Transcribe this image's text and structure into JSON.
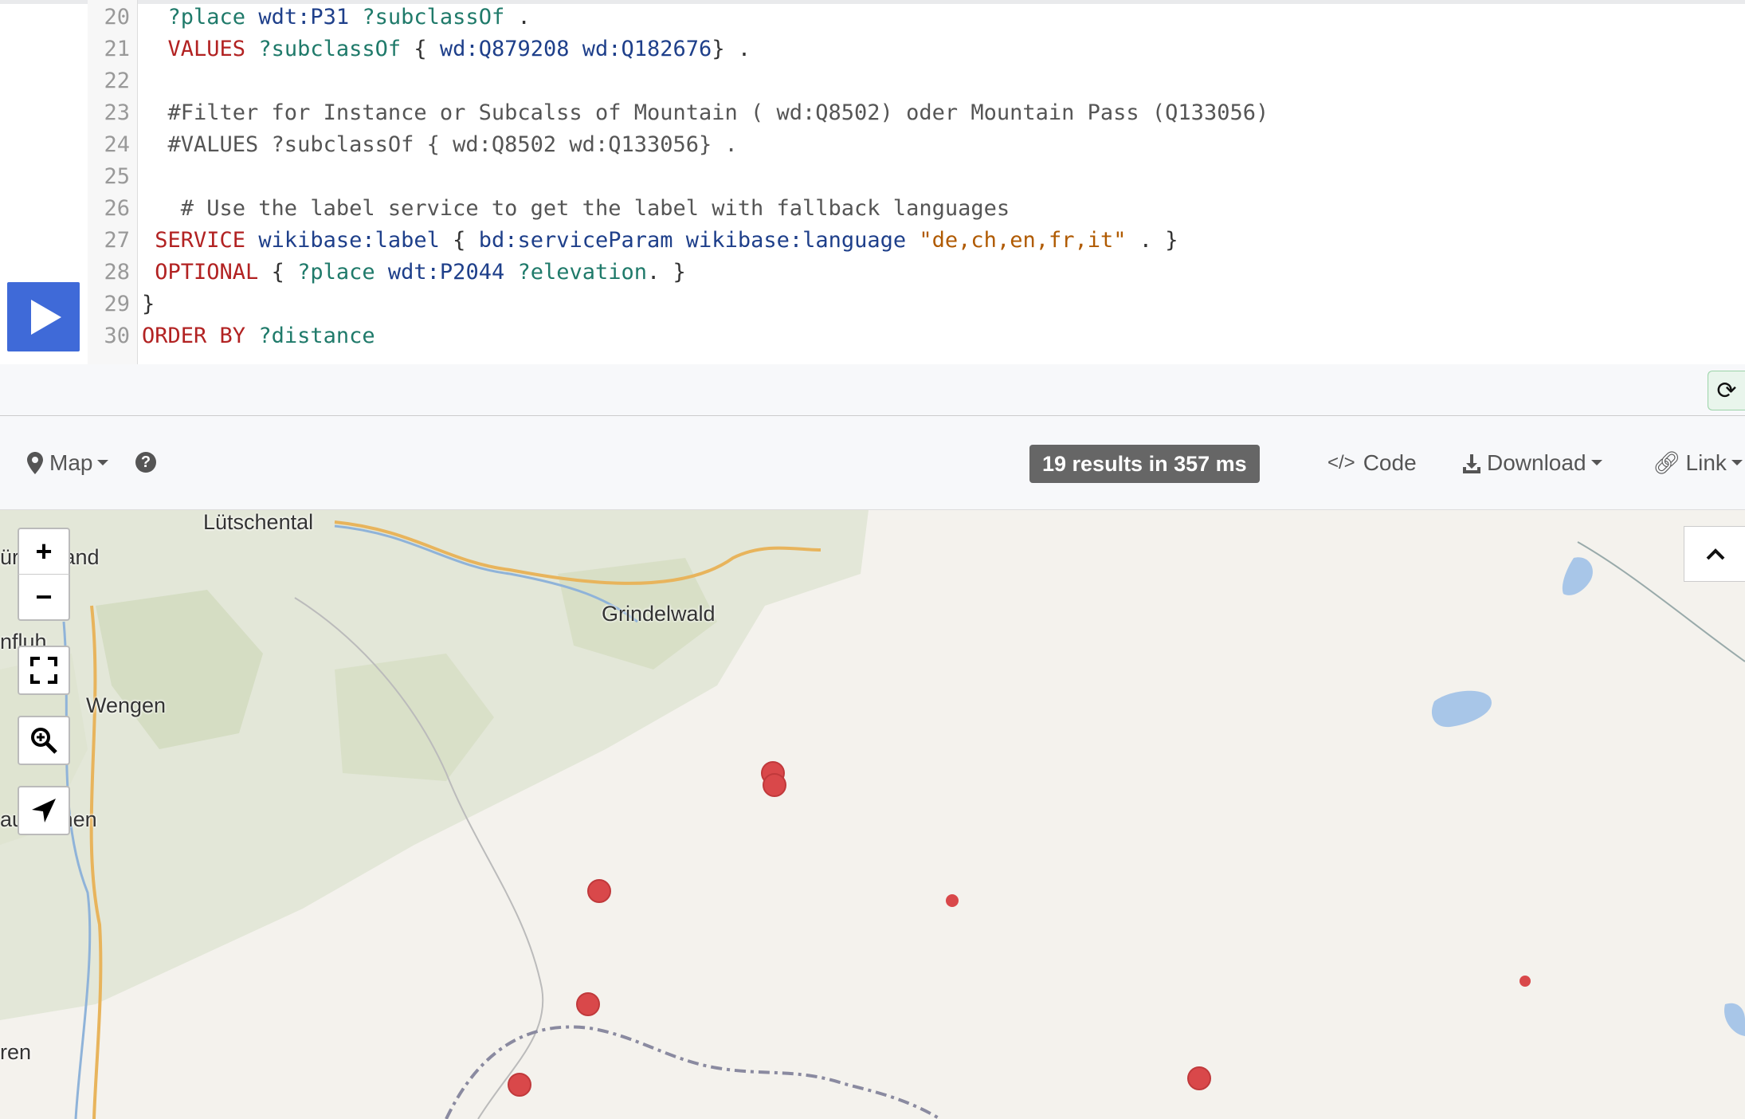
{
  "editor": {
    "run_label": "Run",
    "lines": [
      {
        "n": "20",
        "parts": [
          {
            "t": "  ",
            "c": ""
          },
          {
            "t": "?place",
            "c": "var"
          },
          {
            "t": " ",
            "c": ""
          },
          {
            "t": "wdt:P31",
            "c": "pfx"
          },
          {
            "t": " ",
            "c": ""
          },
          {
            "t": "?subclassOf",
            "c": "var"
          },
          {
            "t": " .",
            "c": ""
          }
        ]
      },
      {
        "n": "21",
        "parts": [
          {
            "t": "  ",
            "c": ""
          },
          {
            "t": "VALUES",
            "c": "kw"
          },
          {
            "t": " ",
            "c": ""
          },
          {
            "t": "?subclassOf",
            "c": "var"
          },
          {
            "t": " { ",
            "c": ""
          },
          {
            "t": "wd:Q879208",
            "c": "pfx"
          },
          {
            "t": " ",
            "c": ""
          },
          {
            "t": "wd:Q182676",
            "c": "pfx"
          },
          {
            "t": "} .",
            "c": ""
          }
        ]
      },
      {
        "n": "22",
        "parts": []
      },
      {
        "n": "23",
        "parts": [
          {
            "t": "  #Filter for Instance or Subcalss of Mountain ( wd:Q8502) oder Mountain Pass (Q133056)",
            "c": "cmt"
          }
        ]
      },
      {
        "n": "24",
        "parts": [
          {
            "t": "  #VALUES ?subclassOf { wd:Q8502 wd:Q133056} .",
            "c": "cmt"
          }
        ]
      },
      {
        "n": "25",
        "parts": []
      },
      {
        "n": "26",
        "parts": [
          {
            "t": "   # Use the label service to get the label with fallback languages",
            "c": "cmt"
          }
        ]
      },
      {
        "n": "27",
        "parts": [
          {
            "t": " ",
            "c": ""
          },
          {
            "t": "SERVICE",
            "c": "kw"
          },
          {
            "t": " ",
            "c": ""
          },
          {
            "t": "wikibase:label",
            "c": "pfx"
          },
          {
            "t": " { ",
            "c": ""
          },
          {
            "t": "bd:serviceParam",
            "c": "pfx"
          },
          {
            "t": " ",
            "c": ""
          },
          {
            "t": "wikibase:language",
            "c": "pfx"
          },
          {
            "t": " ",
            "c": ""
          },
          {
            "t": "\"de,ch,en,fr,it\"",
            "c": "str"
          },
          {
            "t": " . }",
            "c": ""
          }
        ]
      },
      {
        "n": "28",
        "parts": [
          {
            "t": " ",
            "c": ""
          },
          {
            "t": "OPTIONAL",
            "c": "kw"
          },
          {
            "t": " { ",
            "c": ""
          },
          {
            "t": "?place",
            "c": "var"
          },
          {
            "t": " ",
            "c": ""
          },
          {
            "t": "wdt:P2044",
            "c": "pfx"
          },
          {
            "t": " ",
            "c": ""
          },
          {
            "t": "?elevation",
            "c": "var"
          },
          {
            "t": ". }",
            "c": ""
          }
        ]
      },
      {
        "n": "29",
        "parts": [
          {
            "t": "}",
            "c": ""
          }
        ]
      },
      {
        "n": "30",
        "parts": [
          {
            "t": "ORDER BY",
            "c": "kw"
          },
          {
            "t": " ",
            "c": ""
          },
          {
            "t": "?distance",
            "c": "var"
          }
        ]
      }
    ]
  },
  "toolbar": {
    "view_label": "Map",
    "help_glyph": "?",
    "results": "19 results in 357 ms",
    "code_label": "Code",
    "download_label": "Download",
    "link_label": "Link"
  },
  "map": {
    "labels": {
      "lutschental": "Lütschental",
      "grindelwald": "Grindelwald",
      "wengen": "Wengen",
      "schwand": "ür  chwand",
      "nfluh": "nfluh",
      "runnen": "au   runnen",
      "ren": "ren"
    },
    "zoom_in": "+",
    "zoom_out": "−",
    "marker_color": "#d9484a"
  },
  "icons": {
    "refresh": "refresh-icon",
    "collapse": "chevron-up-icon"
  }
}
